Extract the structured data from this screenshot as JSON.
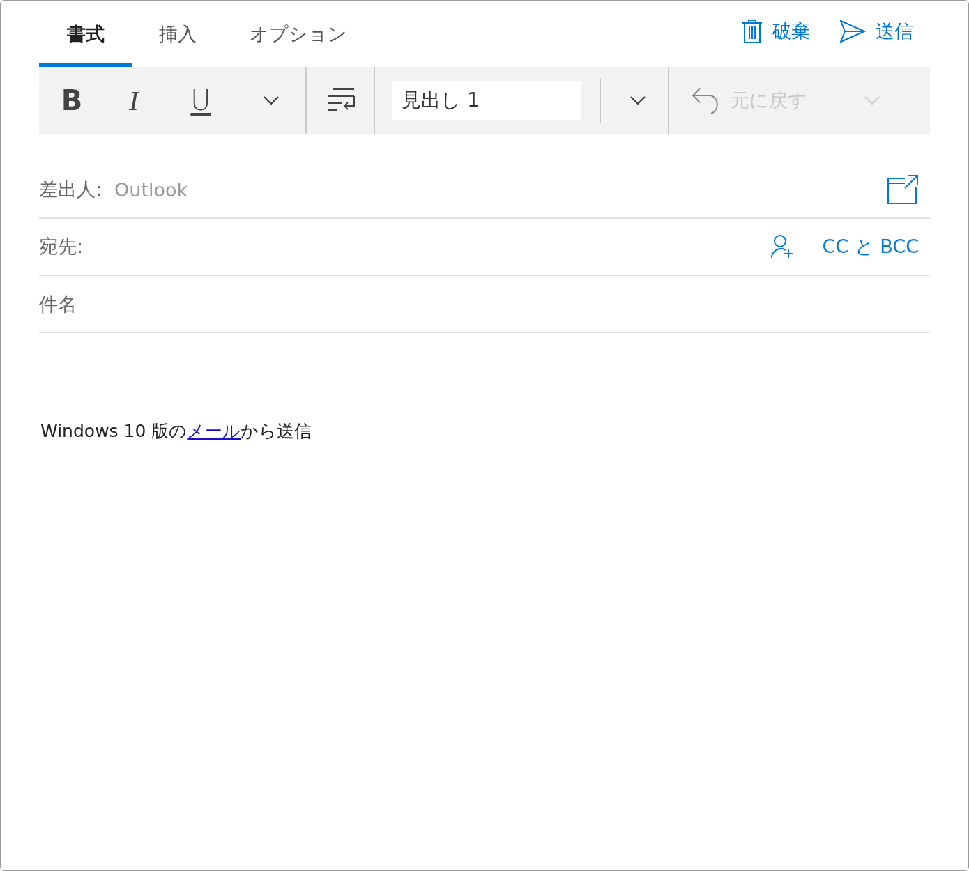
{
  "tabs": [
    {
      "label": "書式",
      "selected": true
    },
    {
      "label": "挿入",
      "selected": false
    },
    {
      "label": "オプション",
      "selected": false
    }
  ],
  "actions": [
    {
      "kind": "discard",
      "label": "破棄"
    },
    {
      "kind": "send",
      "label": "送信"
    }
  ],
  "toolbar": {
    "format_buttons": [
      {
        "kind": "bold",
        "label": "B"
      },
      {
        "kind": "italic",
        "label": "I"
      },
      {
        "kind": "underline",
        "label": "U"
      }
    ],
    "style_field": {
      "value": "見出し 1"
    },
    "undo": {
      "label": "元に戻す",
      "disabled": true
    }
  },
  "from": {
    "label": "差出人:",
    "value": "Outlook"
  },
  "to": {
    "label": "宛先:",
    "cc_bcc": "CC と BCC"
  },
  "subject": {
    "placeholder": "件名"
  },
  "signature": {
    "before": "Windows 10 版の",
    "link": "メール",
    "after": "から送信"
  }
}
